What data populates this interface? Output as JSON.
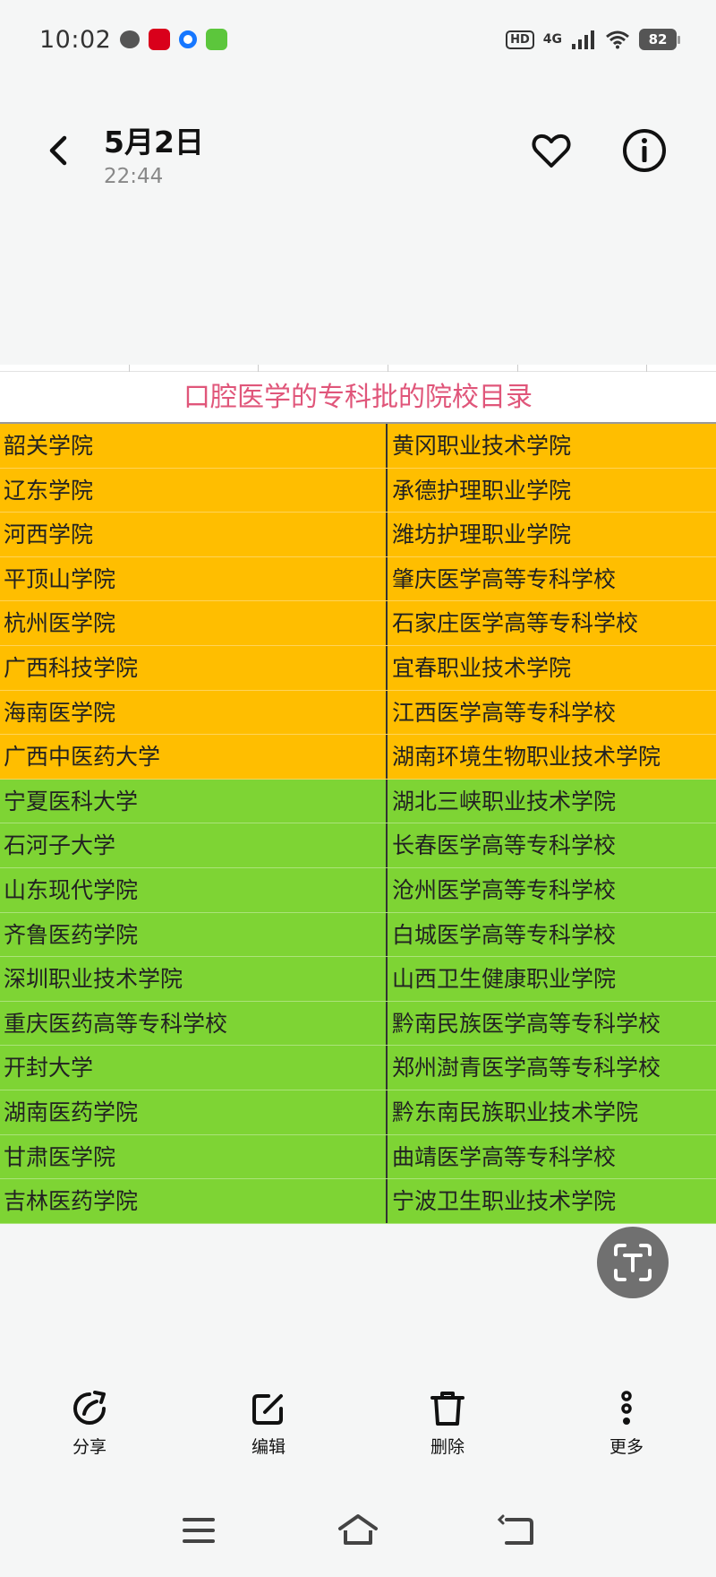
{
  "status_bar": {
    "time": "10:02",
    "hd": "HD",
    "network": "4G",
    "battery": "82"
  },
  "header": {
    "title": "5月2日",
    "subtitle": "22:44"
  },
  "sheet": {
    "title": "口腔医学的专科批的院校目录",
    "rows": [
      {
        "left": "韶关学院",
        "right": "黄冈职业技术学院",
        "color": "orange"
      },
      {
        "left": "辽东学院",
        "right": "承德护理职业学院",
        "color": "orange"
      },
      {
        "left": "河西学院",
        "right": "潍坊护理职业学院",
        "color": "orange"
      },
      {
        "left": "平顶山学院",
        "right": "肇庆医学高等专科学校",
        "color": "orange"
      },
      {
        "left": "杭州医学院",
        "right": "石家庄医学高等专科学校",
        "color": "orange"
      },
      {
        "left": "广西科技学院",
        "right": "宜春职业技术学院",
        "color": "orange"
      },
      {
        "left": "海南医学院",
        "right": "江西医学高等专科学校",
        "color": "orange"
      },
      {
        "left": "广西中医药大学",
        "right": "湖南环境生物职业技术学院",
        "color": "orange"
      },
      {
        "left": "宁夏医科大学",
        "right": "湖北三峡职业技术学院",
        "color": "green"
      },
      {
        "left": "石河子大学",
        "right": "长春医学高等专科学校",
        "color": "green"
      },
      {
        "left": "山东现代学院",
        "right": "沧州医学高等专科学校",
        "color": "green"
      },
      {
        "left": "齐鲁医药学院",
        "right": "白城医学高等专科学校",
        "color": "green"
      },
      {
        "left": "深圳职业技术学院",
        "right": "山西卫生健康职业学院",
        "color": "green"
      },
      {
        "left": "重庆医药高等专科学校",
        "right": "黔南民族医学高等专科学校",
        "color": "green"
      },
      {
        "left": "开封大学",
        "right": "郑州澍青医学高等专科学校",
        "color": "green"
      },
      {
        "left": "湖南医药学院",
        "right": "黔东南民族职业技术学院",
        "color": "green"
      },
      {
        "left": "甘肃医学院",
        "right": "曲靖医学高等专科学校",
        "color": "green"
      },
      {
        "left": "吉林医药学院",
        "right": "宁波卫生职业技术学院",
        "color": "green"
      }
    ]
  },
  "toolbar": {
    "share": "分享",
    "edit": "编辑",
    "delete": "删除",
    "more": "更多"
  },
  "icons": {
    "back": "chevron-left-icon",
    "favorite": "heart-icon",
    "info": "info-icon",
    "scan": "text-scan-icon",
    "share": "share-icon",
    "edit": "edit-icon",
    "delete": "trash-icon",
    "more": "more-vertical-icon",
    "nav_menu": "menu-icon",
    "nav_home": "home-icon",
    "nav_back": "back-icon"
  },
  "colors": {
    "title_pink": "#e0567a",
    "row_orange": "#ffbe00",
    "row_green": "#7ed434"
  }
}
